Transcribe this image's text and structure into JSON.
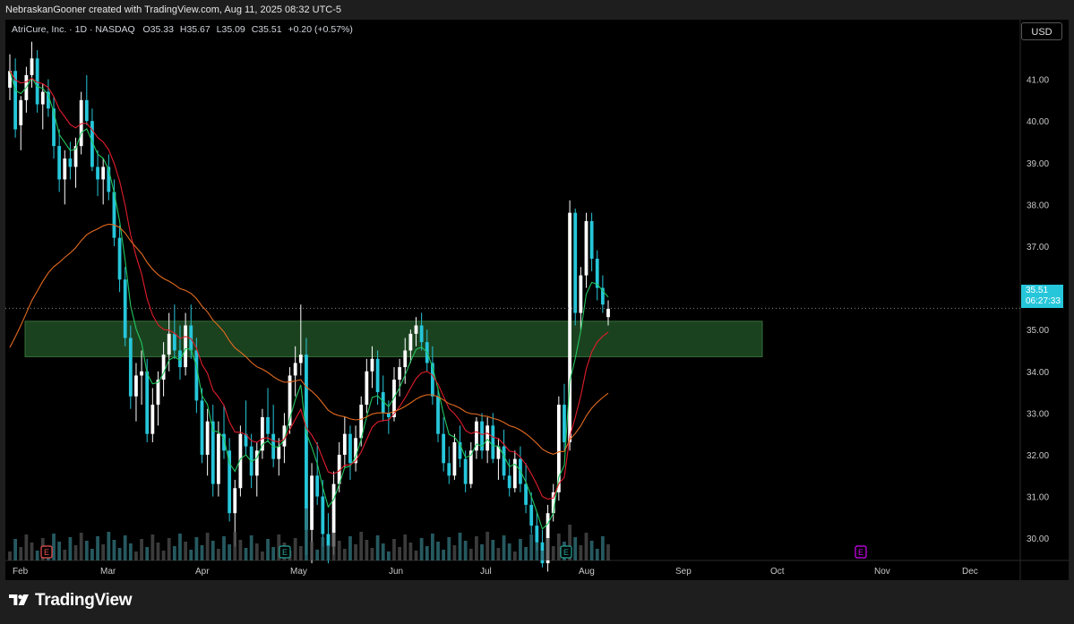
{
  "header": {
    "caption": "NebraskanGooner created with TradingView.com, Aug 11, 2025 08:32 UTC-5"
  },
  "legend": {
    "symbol": "AtriCure, Inc. · 1D · NASDAQ",
    "open_label": "O",
    "open": "35.33",
    "high_label": "H",
    "high": "35.67",
    "low_label": "L",
    "low": "35.09",
    "close_label": "C",
    "close": "35.51",
    "change": "+0.20 (+0.57%)"
  },
  "currency_button": "USD",
  "last_price": {
    "price": "35.51",
    "countdown": "06:27:33"
  },
  "footer": {
    "brand": "TradingView"
  },
  "colors": {
    "up": "#ffffff",
    "down": "#26c6da",
    "ema_short": "#22c55e",
    "ema_mid": "#e11d2b",
    "ema_long": "#e36a1f",
    "zone_fill": "#1f4a23",
    "zone_stroke": "#3a7a3f",
    "earnings_past": "#ef5350",
    "earnings_done": "#26a69a",
    "earnings_future": "#d500f9"
  },
  "chart_data": {
    "type": "candlestick",
    "y_ticks": [
      "41.00",
      "40.00",
      "39.00",
      "38.00",
      "37.00",
      "36.00",
      "35.00",
      "34.00",
      "33.00",
      "32.00",
      "31.00",
      "30.00"
    ],
    "x_ticks": [
      "Feb",
      "Mar",
      "Apr",
      "May",
      "Jun",
      "Jul",
      "Aug",
      "Sep",
      "Oct",
      "Nov",
      "Dec"
    ],
    "ylim": [
      29.0,
      42.0
    ],
    "support_zone": [
      34.35,
      35.2
    ],
    "last_close": 35.51,
    "earnings_markers": [
      {
        "label": "E",
        "date": "Feb-20",
        "status": "past"
      },
      {
        "label": "E",
        "date": "May-01",
        "status": "done"
      },
      {
        "label": "E",
        "date": "Jul-29",
        "status": "done"
      },
      {
        "label": "E",
        "date": "Nov-01",
        "status": "future"
      }
    ],
    "ohlc": [
      [
        40.8,
        41.6,
        40.5,
        41.2
      ],
      [
        41.2,
        41.5,
        39.6,
        39.8
      ],
      [
        39.9,
        40.6,
        39.3,
        40.5
      ],
      [
        40.5,
        41.3,
        40.2,
        41.1
      ],
      [
        41.1,
        41.9,
        40.8,
        41.5
      ],
      [
        41.5,
        41.7,
        40.2,
        40.4
      ],
      [
        40.4,
        40.9,
        39.8,
        40.7
      ],
      [
        40.7,
        41.0,
        40.1,
        40.3
      ],
      [
        40.3,
        40.6,
        39.1,
        39.4
      ],
      [
        39.4,
        39.8,
        38.3,
        38.6
      ],
      [
        38.6,
        39.3,
        38.0,
        39.1
      ],
      [
        39.1,
        39.5,
        38.6,
        38.9
      ],
      [
        38.9,
        39.6,
        38.4,
        39.4
      ],
      [
        39.4,
        40.7,
        39.2,
        40.5
      ],
      [
        40.5,
        41.1,
        39.9,
        40.0
      ],
      [
        40.0,
        40.3,
        38.8,
        38.9
      ],
      [
        38.9,
        39.3,
        38.2,
        38.6
      ],
      [
        38.6,
        39.1,
        38.0,
        38.9
      ],
      [
        38.9,
        39.2,
        38.1,
        38.3
      ],
      [
        38.3,
        38.6,
        37.0,
        37.2
      ],
      [
        37.2,
        37.5,
        35.9,
        36.2
      ],
      [
        36.2,
        36.5,
        34.6,
        34.8
      ],
      [
        34.8,
        35.1,
        33.1,
        33.4
      ],
      [
        33.4,
        34.2,
        32.8,
        33.9
      ],
      [
        33.9,
        34.5,
        33.2,
        34.0
      ],
      [
        34.0,
        34.3,
        32.3,
        32.5
      ],
      [
        32.5,
        33.6,
        32.3,
        33.2
      ],
      [
        33.2,
        34.0,
        32.7,
        33.8
      ],
      [
        33.8,
        34.7,
        33.4,
        34.4
      ],
      [
        34.4,
        35.4,
        34.0,
        34.9
      ],
      [
        34.9,
        35.6,
        34.3,
        34.5
      ],
      [
        34.5,
        35.1,
        33.8,
        34.1
      ],
      [
        34.1,
        35.4,
        33.9,
        35.1
      ],
      [
        35.1,
        35.6,
        34.3,
        34.5
      ],
      [
        34.5,
        34.8,
        33.0,
        33.3
      ],
      [
        33.3,
        33.6,
        31.8,
        32.0
      ],
      [
        32.0,
        33.1,
        31.5,
        32.8
      ],
      [
        32.8,
        33.2,
        31.0,
        31.3
      ],
      [
        31.3,
        32.8,
        31.0,
        32.5
      ],
      [
        32.5,
        33.2,
        31.9,
        32.1
      ],
      [
        32.1,
        32.4,
        30.4,
        30.6
      ],
      [
        30.6,
        31.4,
        29.8,
        31.2
      ],
      [
        31.2,
        32.7,
        31.0,
        32.5
      ],
      [
        32.5,
        33.3,
        32.0,
        32.2
      ],
      [
        32.2,
        32.5,
        31.2,
        31.5
      ],
      [
        31.5,
        32.3,
        31.0,
        32.1
      ],
      [
        32.1,
        33.1,
        31.9,
        32.9
      ],
      [
        32.9,
        33.6,
        32.3,
        32.5
      ],
      [
        32.5,
        33.2,
        31.7,
        31.9
      ],
      [
        31.9,
        32.4,
        31.5,
        32.2
      ],
      [
        32.2,
        33.0,
        31.8,
        32.7
      ],
      [
        32.7,
        34.1,
        32.5,
        33.9
      ],
      [
        33.9,
        34.6,
        33.4,
        34.2
      ],
      [
        34.2,
        35.6,
        33.9,
        34.4
      ],
      [
        34.4,
        34.8,
        29.6,
        30.2
      ],
      [
        30.2,
        31.8,
        29.4,
        31.5
      ],
      [
        31.5,
        32.3,
        30.8,
        31.0
      ],
      [
        31.0,
        31.4,
        29.8,
        30.1
      ],
      [
        30.1,
        30.6,
        29.4,
        29.8
      ],
      [
        29.8,
        31.6,
        29.6,
        31.3
      ],
      [
        31.3,
        32.3,
        31.1,
        32.0
      ],
      [
        32.0,
        32.9,
        31.7,
        32.5
      ],
      [
        32.5,
        32.7,
        31.4,
        31.8
      ],
      [
        31.8,
        32.7,
        31.6,
        32.4
      ],
      [
        32.4,
        33.4,
        32.2,
        33.2
      ],
      [
        33.2,
        34.3,
        33.0,
        34.0
      ],
      [
        34.0,
        34.6,
        33.6,
        34.3
      ],
      [
        34.3,
        34.5,
        33.2,
        33.5
      ],
      [
        33.5,
        33.9,
        32.8,
        33.0
      ],
      [
        33.0,
        33.3,
        32.5,
        32.9
      ],
      [
        32.9,
        34.1,
        32.8,
        33.8
      ],
      [
        33.8,
        34.3,
        33.4,
        34.1
      ],
      [
        34.1,
        34.8,
        33.7,
        34.5
      ],
      [
        34.5,
        35.0,
        34.2,
        34.9
      ],
      [
        34.9,
        35.3,
        34.6,
        35.1
      ],
      [
        35.1,
        35.4,
        34.5,
        34.7
      ],
      [
        34.7,
        35.0,
        34.0,
        34.2
      ],
      [
        34.2,
        34.6,
        33.2,
        33.4
      ],
      [
        33.4,
        33.6,
        32.3,
        32.5
      ],
      [
        32.5,
        32.9,
        31.6,
        31.8
      ],
      [
        31.8,
        32.2,
        31.3,
        31.5
      ],
      [
        31.5,
        32.5,
        31.4,
        32.3
      ],
      [
        32.3,
        32.7,
        31.7,
        31.9
      ],
      [
        31.9,
        32.1,
        31.1,
        31.3
      ],
      [
        31.3,
        32.3,
        31.2,
        32.1
      ],
      [
        32.1,
        32.9,
        31.9,
        32.8
      ],
      [
        32.8,
        33.0,
        31.9,
        32.1
      ],
      [
        32.1,
        32.9,
        31.8,
        32.7
      ],
      [
        32.7,
        33.0,
        31.8,
        31.9
      ],
      [
        31.9,
        32.4,
        31.4,
        32.2
      ],
      [
        32.2,
        32.6,
        31.4,
        31.5
      ],
      [
        31.5,
        31.9,
        31.0,
        31.2
      ],
      [
        31.2,
        32.1,
        31.1,
        31.9
      ],
      [
        31.9,
        32.2,
        31.1,
        31.3
      ],
      [
        31.3,
        31.8,
        30.6,
        30.8
      ],
      [
        30.8,
        31.1,
        30.1,
        30.3
      ],
      [
        30.3,
        30.6,
        29.7,
        29.9
      ],
      [
        29.9,
        30.2,
        29.3,
        29.4
      ],
      [
        29.4,
        30.8,
        29.2,
        30.6
      ],
      [
        30.6,
        31.3,
        30.4,
        31.1
      ],
      [
        31.1,
        33.4,
        30.9,
        33.2
      ],
      [
        33.2,
        33.7,
        32.1,
        32.3
      ],
      [
        32.3,
        38.1,
        32.1,
        37.8
      ],
      [
        37.8,
        37.9,
        35.1,
        35.4
      ],
      [
        35.4,
        36.5,
        35.0,
        36.3
      ],
      [
        36.3,
        37.8,
        36.0,
        37.6
      ],
      [
        37.6,
        37.8,
        36.4,
        36.7
      ],
      [
        36.7,
        36.9,
        35.7,
        36.0
      ],
      [
        36.0,
        36.3,
        35.4,
        35.6
      ],
      [
        35.3,
        35.7,
        35.1,
        35.5
      ]
    ]
  }
}
